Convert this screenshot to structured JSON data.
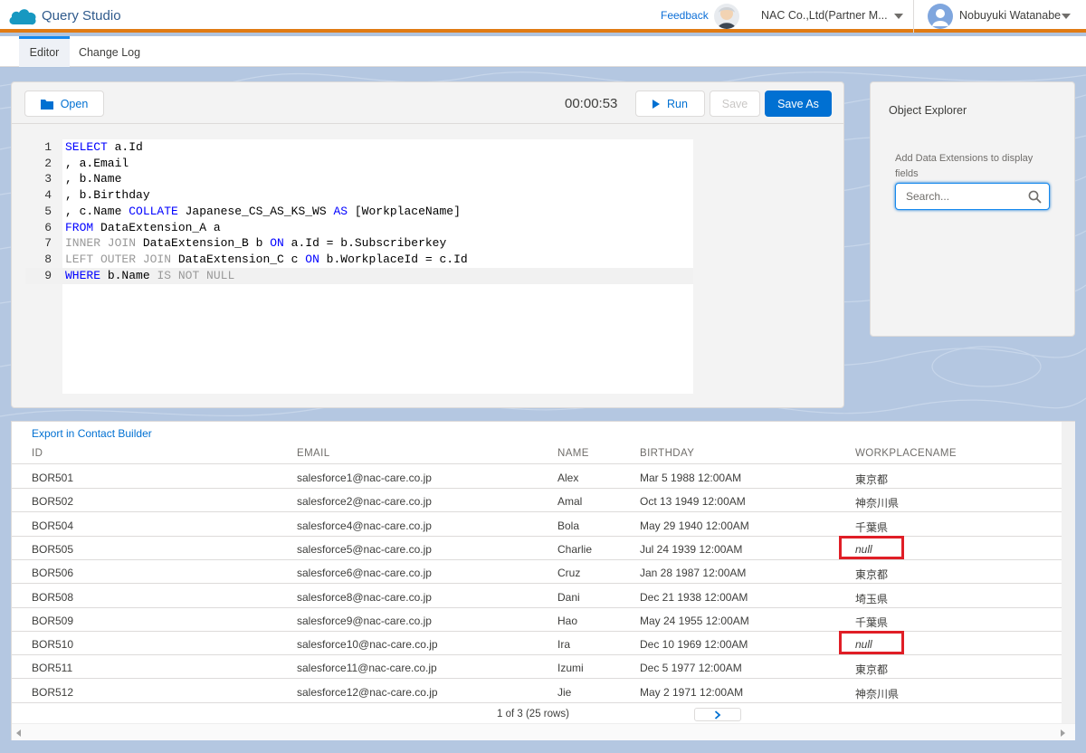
{
  "header": {
    "app_title": "Query Studio",
    "feedback_label": "Feedback",
    "org_name": "NAC Co.,Ltd(Partner M...",
    "user_name": "Nobuyuki Watanabe",
    "logo_icon": "salesforce-cloud-icon",
    "accent_color": "#e07b14"
  },
  "tabs": [
    {
      "label": "Editor",
      "active": true
    },
    {
      "label": "Change Log",
      "active": false
    }
  ],
  "toolbar": {
    "open_label": "Open",
    "timer": "00:00:53",
    "run_label": "Run",
    "save_label": "Save",
    "save_as_label": "Save As"
  },
  "editor": {
    "lines": [
      {
        "n": "1",
        "segments": [
          {
            "t": "SELECT",
            "c": "kw"
          },
          {
            "t": " a.Id",
            "c": ""
          }
        ]
      },
      {
        "n": "2",
        "segments": [
          {
            "t": ", a.Email",
            "c": ""
          }
        ]
      },
      {
        "n": "3",
        "segments": [
          {
            "t": ", b.Name",
            "c": ""
          }
        ]
      },
      {
        "n": "4",
        "segments": [
          {
            "t": ", b.Birthday",
            "c": ""
          }
        ]
      },
      {
        "n": "5",
        "segments": [
          {
            "t": ", c.Name ",
            "c": ""
          },
          {
            "t": "COLLATE",
            "c": "kw"
          },
          {
            "t": " Japanese_CS_AS_KS_WS ",
            "c": ""
          },
          {
            "t": "AS",
            "c": "kw"
          },
          {
            "t": " [WorkplaceName]",
            "c": ""
          }
        ]
      },
      {
        "n": "6",
        "segments": [
          {
            "t": "FROM",
            "c": "kw"
          },
          {
            "t": " DataExtension_A a",
            "c": ""
          }
        ]
      },
      {
        "n": "7",
        "segments": [
          {
            "t": "INNER JOIN",
            "c": "kw2"
          },
          {
            "t": " DataExtension_B b ",
            "c": ""
          },
          {
            "t": "ON",
            "c": "kw"
          },
          {
            "t": " a.Id = b.Subscriberkey",
            "c": ""
          }
        ]
      },
      {
        "n": "8",
        "segments": [
          {
            "t": "LEFT OUTER JOIN",
            "c": "kw2"
          },
          {
            "t": " DataExtension_C c ",
            "c": ""
          },
          {
            "t": "ON",
            "c": "kw"
          },
          {
            "t": " b.WorkplaceId = c.Id",
            "c": ""
          }
        ]
      },
      {
        "n": "9",
        "segments": [
          {
            "t": "WHERE",
            "c": "kw"
          },
          {
            "t": " b.Name ",
            "c": ""
          },
          {
            "t": "IS NOT NULL",
            "c": "kw2"
          }
        ]
      }
    ],
    "current_line": "9"
  },
  "explorer": {
    "title": "Object Explorer",
    "help_text": "Add Data Extensions to display fields",
    "search_placeholder": "Search..."
  },
  "results": {
    "export_label": "Export in Contact Builder",
    "columns": [
      "ID",
      "EMAIL",
      "NAME",
      "BIRTHDAY",
      "WORKPLACENAME"
    ],
    "rows": [
      [
        "BOR501",
        "salesforce1@nac-care.co.jp",
        "Alex",
        "Mar 5 1988 12:00AM",
        "東京都"
      ],
      [
        "BOR502",
        "salesforce2@nac-care.co.jp",
        "Amal",
        "Oct 13 1949 12:00AM",
        "神奈川県"
      ],
      [
        "BOR504",
        "salesforce4@nac-care.co.jp",
        "Bola",
        "May 29 1940 12:00AM",
        "千葉県"
      ],
      [
        "BOR505",
        "salesforce5@nac-care.co.jp",
        "Charlie",
        "Jul 24 1939 12:00AM",
        "null"
      ],
      [
        "BOR506",
        "salesforce6@nac-care.co.jp",
        "Cruz",
        "Jan 28 1987 12:00AM",
        "東京都"
      ],
      [
        "BOR508",
        "salesforce8@nac-care.co.jp",
        "Dani",
        "Dec 21 1938 12:00AM",
        "埼玉県"
      ],
      [
        "BOR509",
        "salesforce9@nac-care.co.jp",
        "Hao",
        "May 24 1955 12:00AM",
        "千葉県"
      ],
      [
        "BOR510",
        "salesforce10@nac-care.co.jp",
        "Ira",
        "Dec 10 1969 12:00AM",
        "null"
      ],
      [
        "BOR511",
        "salesforce11@nac-care.co.jp",
        "Izumi",
        "Dec 5 1977 12:00AM",
        "東京都"
      ],
      [
        "BOR512",
        "salesforce12@nac-care.co.jp",
        "Jie",
        "May 2 1971 12:00AM",
        "神奈川県"
      ]
    ],
    "highlighted_rows": [
      3,
      7
    ],
    "pagination": "1 of 3 (25 rows)"
  }
}
